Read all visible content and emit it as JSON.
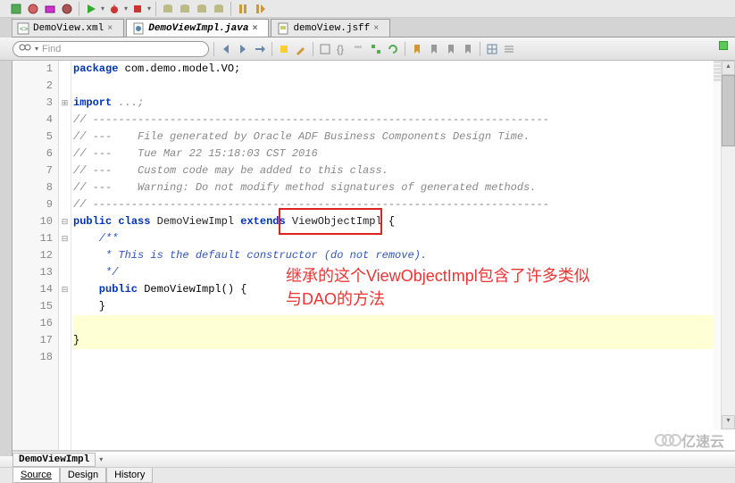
{
  "tabs": [
    {
      "label": "DemoView.xml",
      "active": false
    },
    {
      "label": "DemoViewImpl.java",
      "active": true
    },
    {
      "label": "demoView.jsff",
      "active": false
    }
  ],
  "find": {
    "placeholder": "Find"
  },
  "code": {
    "l1_kw": "package",
    "l1_rest": " com.demo.model.VO;",
    "l3_kw": "import",
    "l3_rest": " ...;",
    "l4": "// -----------------------------------------------------------------------",
    "l5": "// ---    File generated by Oracle ADF Business Components Design Time.",
    "l6": "// ---    Tue Mar 22 15:18:03 CST 2016",
    "l7": "// ---    Custom code may be added to this class.",
    "l8": "// ---    Warning: Do not modify method signatures of generated methods.",
    "l9": "// -----------------------------------------------------------------------",
    "l10_kw1": "public",
    "l10_kw2": "class",
    "l10_name": " DemoViewImpl ",
    "l10_kw3": "extends",
    "l10_ext": " ViewObjectImpl ",
    "l10_end": "{",
    "l11": "    /**",
    "l12": "     * This is the default constructor (do not remove).",
    "l13": "     */",
    "l14_kw": "    public",
    "l14_rest": " DemoViewImpl() {",
    "l15": "    }",
    "l17": "}"
  },
  "annotation": {
    "line1": "继承的这个ViewObjectImpl包含了许多类似",
    "line2": "与DAO的方法"
  },
  "breadcrumb": {
    "item": "DemoViewImpl"
  },
  "bottomTabs": {
    "source": "Source",
    "design": "Design",
    "history": "History"
  },
  "watermark": "亿速云"
}
